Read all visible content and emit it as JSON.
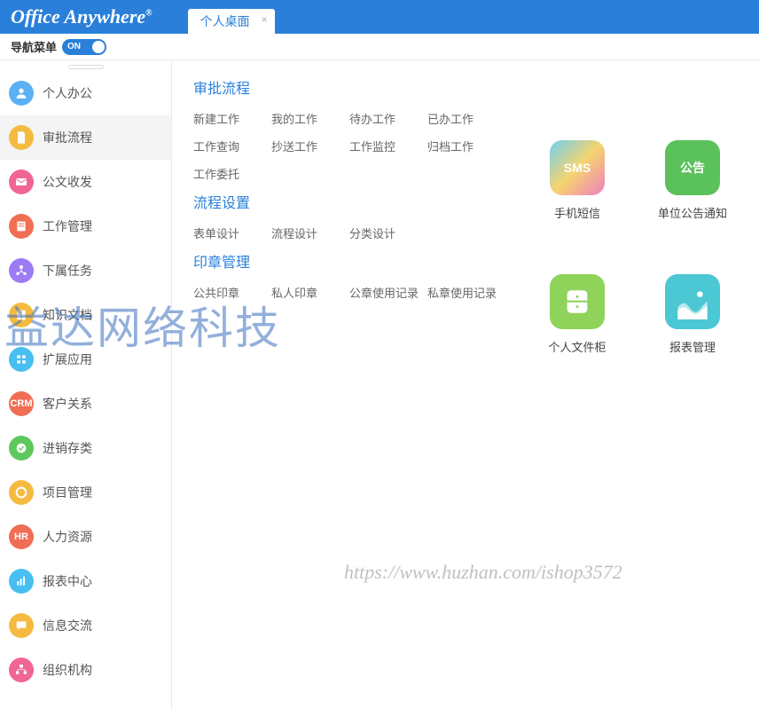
{
  "header": {
    "logo": "Office Anywhere",
    "tab": "个人桌面"
  },
  "subheader": {
    "label": "导航菜单",
    "toggle": "ON"
  },
  "sidebar": {
    "items": [
      {
        "label": "个人办公",
        "color": "#5ab0f2",
        "icon": "user"
      },
      {
        "label": "审批流程",
        "color": "#f5bb40",
        "icon": "doc",
        "active": true
      },
      {
        "label": "公文收发",
        "color": "#f06693",
        "icon": "mail"
      },
      {
        "label": "工作管理",
        "color": "#f06e54",
        "icon": "list"
      },
      {
        "label": "下属任务",
        "color": "#9e7bf4",
        "icon": "sub"
      },
      {
        "label": "知识文档",
        "color": "#f5bb40",
        "icon": "book"
      },
      {
        "label": "扩展应用",
        "color": "#47bff0",
        "icon": "app"
      },
      {
        "label": "客户关系",
        "color": "#f06e54",
        "icon": "CRM"
      },
      {
        "label": "进销存类",
        "color": "#5dc95d",
        "icon": "stock"
      },
      {
        "label": "项目管理",
        "color": "#f5bb40",
        "icon": "proj"
      },
      {
        "label": "人力资源",
        "color": "#f06e54",
        "icon": "HR"
      },
      {
        "label": "报表中心",
        "color": "#47bff0",
        "icon": "chart"
      },
      {
        "label": "信息交流",
        "color": "#f5bb40",
        "icon": "chat"
      },
      {
        "label": "组织机构",
        "color": "#f06693",
        "icon": "org"
      }
    ]
  },
  "flyout": {
    "sections": [
      {
        "title": "审批流程",
        "items": [
          "新建工作",
          "我的工作",
          "待办工作",
          "已办工作",
          "工作查询",
          "抄送工作",
          "工作监控",
          "归档工作",
          "工作委托"
        ]
      },
      {
        "title": "流程设置",
        "items": [
          "表单设计",
          "流程设计",
          "分类设计"
        ]
      },
      {
        "title": "印章管理",
        "items": [
          "公共印章",
          "私人印章",
          "公章使用记录",
          "私章使用记录"
        ]
      }
    ]
  },
  "desktop": {
    "apps": [
      {
        "label": "手机短信",
        "bg": "linear-gradient(135deg,#6fd0f2,#f5d46e,#f07ec0)",
        "text": "SMS"
      },
      {
        "label": "单位公告通知",
        "bg": "#5bc15b",
        "text": "公告"
      },
      {
        "label": "个人文件柜",
        "bg": "#8fd35b",
        "text": ""
      },
      {
        "label": "报表管理",
        "bg": "#4cc7d4",
        "text": ""
      }
    ]
  },
  "watermarks": {
    "wm1": "益达网络科技",
    "wm2": "https://www.huzhan.com/ishop3572"
  }
}
